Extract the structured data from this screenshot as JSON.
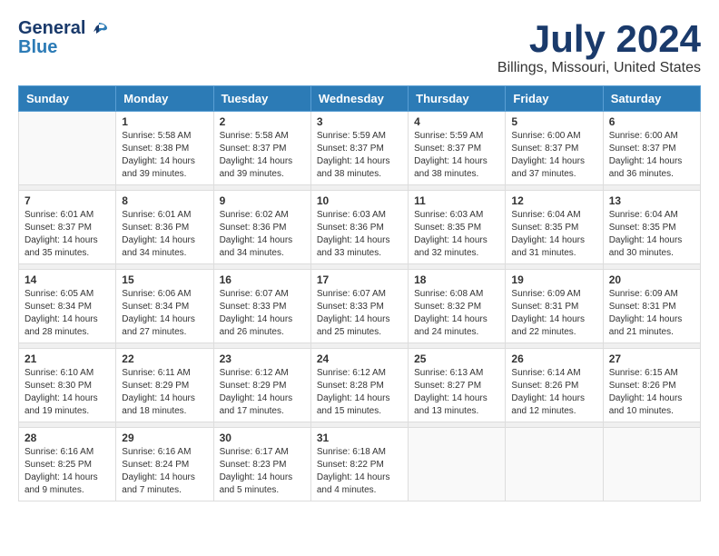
{
  "logo": {
    "general": "General",
    "blue": "Blue"
  },
  "title": "July 2024",
  "location": "Billings, Missouri, United States",
  "weekdays": [
    "Sunday",
    "Monday",
    "Tuesday",
    "Wednesday",
    "Thursday",
    "Friday",
    "Saturday"
  ],
  "weeks": [
    [
      {
        "day": "",
        "sunrise": "",
        "sunset": "",
        "daylight": ""
      },
      {
        "day": "1",
        "sunrise": "Sunrise: 5:58 AM",
        "sunset": "Sunset: 8:38 PM",
        "daylight": "Daylight: 14 hours and 39 minutes."
      },
      {
        "day": "2",
        "sunrise": "Sunrise: 5:58 AM",
        "sunset": "Sunset: 8:37 PM",
        "daylight": "Daylight: 14 hours and 39 minutes."
      },
      {
        "day": "3",
        "sunrise": "Sunrise: 5:59 AM",
        "sunset": "Sunset: 8:37 PM",
        "daylight": "Daylight: 14 hours and 38 minutes."
      },
      {
        "day": "4",
        "sunrise": "Sunrise: 5:59 AM",
        "sunset": "Sunset: 8:37 PM",
        "daylight": "Daylight: 14 hours and 38 minutes."
      },
      {
        "day": "5",
        "sunrise": "Sunrise: 6:00 AM",
        "sunset": "Sunset: 8:37 PM",
        "daylight": "Daylight: 14 hours and 37 minutes."
      },
      {
        "day": "6",
        "sunrise": "Sunrise: 6:00 AM",
        "sunset": "Sunset: 8:37 PM",
        "daylight": "Daylight: 14 hours and 36 minutes."
      }
    ],
    [
      {
        "day": "7",
        "sunrise": "Sunrise: 6:01 AM",
        "sunset": "Sunset: 8:37 PM",
        "daylight": "Daylight: 14 hours and 35 minutes."
      },
      {
        "day": "8",
        "sunrise": "Sunrise: 6:01 AM",
        "sunset": "Sunset: 8:36 PM",
        "daylight": "Daylight: 14 hours and 34 minutes."
      },
      {
        "day": "9",
        "sunrise": "Sunrise: 6:02 AM",
        "sunset": "Sunset: 8:36 PM",
        "daylight": "Daylight: 14 hours and 34 minutes."
      },
      {
        "day": "10",
        "sunrise": "Sunrise: 6:03 AM",
        "sunset": "Sunset: 8:36 PM",
        "daylight": "Daylight: 14 hours and 33 minutes."
      },
      {
        "day": "11",
        "sunrise": "Sunrise: 6:03 AM",
        "sunset": "Sunset: 8:35 PM",
        "daylight": "Daylight: 14 hours and 32 minutes."
      },
      {
        "day": "12",
        "sunrise": "Sunrise: 6:04 AM",
        "sunset": "Sunset: 8:35 PM",
        "daylight": "Daylight: 14 hours and 31 minutes."
      },
      {
        "day": "13",
        "sunrise": "Sunrise: 6:04 AM",
        "sunset": "Sunset: 8:35 PM",
        "daylight": "Daylight: 14 hours and 30 minutes."
      }
    ],
    [
      {
        "day": "14",
        "sunrise": "Sunrise: 6:05 AM",
        "sunset": "Sunset: 8:34 PM",
        "daylight": "Daylight: 14 hours and 28 minutes."
      },
      {
        "day": "15",
        "sunrise": "Sunrise: 6:06 AM",
        "sunset": "Sunset: 8:34 PM",
        "daylight": "Daylight: 14 hours and 27 minutes."
      },
      {
        "day": "16",
        "sunrise": "Sunrise: 6:07 AM",
        "sunset": "Sunset: 8:33 PM",
        "daylight": "Daylight: 14 hours and 26 minutes."
      },
      {
        "day": "17",
        "sunrise": "Sunrise: 6:07 AM",
        "sunset": "Sunset: 8:33 PM",
        "daylight": "Daylight: 14 hours and 25 minutes."
      },
      {
        "day": "18",
        "sunrise": "Sunrise: 6:08 AM",
        "sunset": "Sunset: 8:32 PM",
        "daylight": "Daylight: 14 hours and 24 minutes."
      },
      {
        "day": "19",
        "sunrise": "Sunrise: 6:09 AM",
        "sunset": "Sunset: 8:31 PM",
        "daylight": "Daylight: 14 hours and 22 minutes."
      },
      {
        "day": "20",
        "sunrise": "Sunrise: 6:09 AM",
        "sunset": "Sunset: 8:31 PM",
        "daylight": "Daylight: 14 hours and 21 minutes."
      }
    ],
    [
      {
        "day": "21",
        "sunrise": "Sunrise: 6:10 AM",
        "sunset": "Sunset: 8:30 PM",
        "daylight": "Daylight: 14 hours and 19 minutes."
      },
      {
        "day": "22",
        "sunrise": "Sunrise: 6:11 AM",
        "sunset": "Sunset: 8:29 PM",
        "daylight": "Daylight: 14 hours and 18 minutes."
      },
      {
        "day": "23",
        "sunrise": "Sunrise: 6:12 AM",
        "sunset": "Sunset: 8:29 PM",
        "daylight": "Daylight: 14 hours and 17 minutes."
      },
      {
        "day": "24",
        "sunrise": "Sunrise: 6:12 AM",
        "sunset": "Sunset: 8:28 PM",
        "daylight": "Daylight: 14 hours and 15 minutes."
      },
      {
        "day": "25",
        "sunrise": "Sunrise: 6:13 AM",
        "sunset": "Sunset: 8:27 PM",
        "daylight": "Daylight: 14 hours and 13 minutes."
      },
      {
        "day": "26",
        "sunrise": "Sunrise: 6:14 AM",
        "sunset": "Sunset: 8:26 PM",
        "daylight": "Daylight: 14 hours and 12 minutes."
      },
      {
        "day": "27",
        "sunrise": "Sunrise: 6:15 AM",
        "sunset": "Sunset: 8:26 PM",
        "daylight": "Daylight: 14 hours and 10 minutes."
      }
    ],
    [
      {
        "day": "28",
        "sunrise": "Sunrise: 6:16 AM",
        "sunset": "Sunset: 8:25 PM",
        "daylight": "Daylight: 14 hours and 9 minutes."
      },
      {
        "day": "29",
        "sunrise": "Sunrise: 6:16 AM",
        "sunset": "Sunset: 8:24 PM",
        "daylight": "Daylight: 14 hours and 7 minutes."
      },
      {
        "day": "30",
        "sunrise": "Sunrise: 6:17 AM",
        "sunset": "Sunset: 8:23 PM",
        "daylight": "Daylight: 14 hours and 5 minutes."
      },
      {
        "day": "31",
        "sunrise": "Sunrise: 6:18 AM",
        "sunset": "Sunset: 8:22 PM",
        "daylight": "Daylight: 14 hours and 4 minutes."
      },
      {
        "day": "",
        "sunrise": "",
        "sunset": "",
        "daylight": ""
      },
      {
        "day": "",
        "sunrise": "",
        "sunset": "",
        "daylight": ""
      },
      {
        "day": "",
        "sunrise": "",
        "sunset": "",
        "daylight": ""
      }
    ]
  ]
}
